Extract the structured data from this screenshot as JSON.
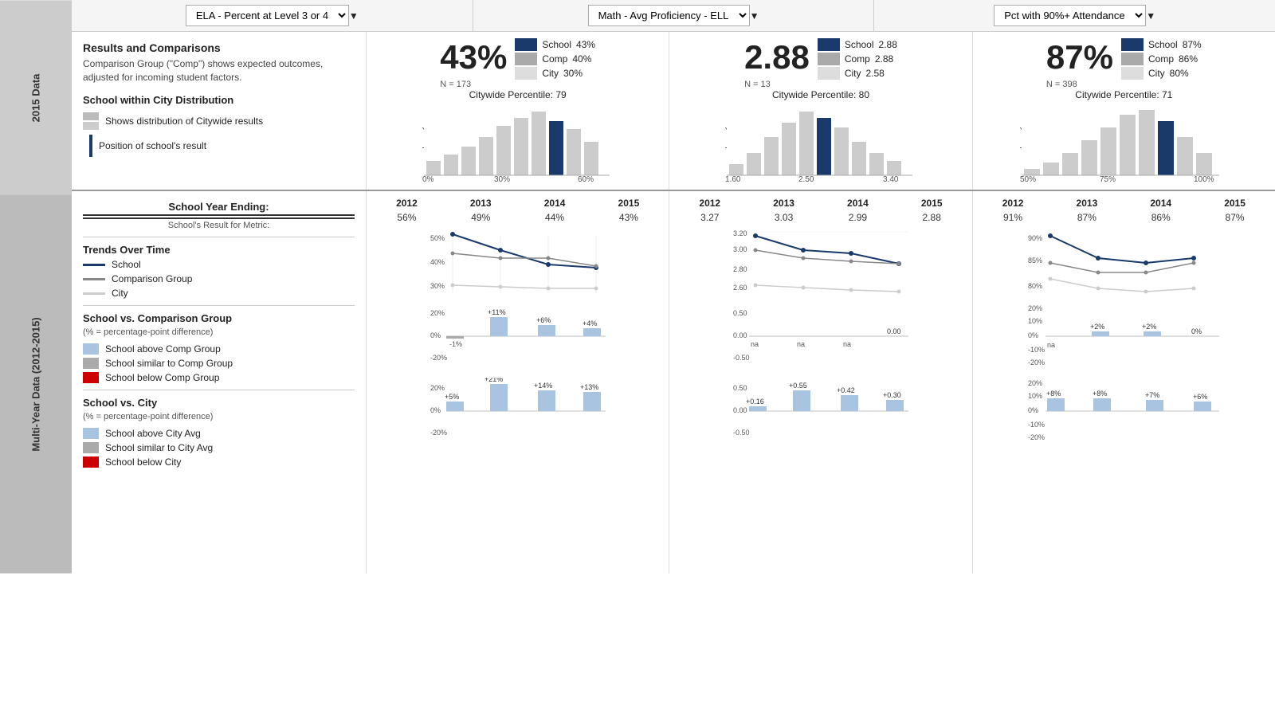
{
  "dropdowns": [
    {
      "label": "ELA - Percent at Level 3 or 4",
      "name": "ela-dropdown"
    },
    {
      "label": "Math - Avg Proficiency - ELL",
      "name": "math-dropdown"
    },
    {
      "label": "Pct with 90%+ Attendance",
      "name": "attendance-dropdown"
    }
  ],
  "sidebar_labels": [
    {
      "text": "2015 Data",
      "section": "top"
    },
    {
      "text": "Multi-Year Data (2012-2015)",
      "section": "bottom"
    }
  ],
  "results_section": {
    "title": "Results and Comparisons",
    "description": "Comparison Group (\"Comp\") shows expected outcomes, adjusted for incoming student factors.",
    "dist_legend": [
      {
        "icon": "bar",
        "text": "Shows distribution of Citywide results"
      },
      {
        "icon": "line",
        "text": "Position of school's result"
      }
    ]
  },
  "metrics": [
    {
      "id": "ela",
      "big_value": "43%",
      "n_label": "N = 173",
      "stats": [
        {
          "label": "School",
          "value": "43%",
          "swatch": "dark-blue"
        },
        {
          "label": "Comp",
          "value": "40%",
          "swatch": "gray"
        },
        {
          "label": "City",
          "value": "30%",
          "swatch": "light-gray"
        }
      ],
      "citywide_percentile": "Citywide Percentile: 79",
      "hist_bars": [
        12,
        18,
        22,
        30,
        38,
        45,
        55,
        42,
        35,
        28
      ],
      "hist_highlight": 7,
      "x_axis": [
        "0%",
        "30%",
        "60%"
      ],
      "trend_years": [
        "2012",
        "2013",
        "2014",
        "2015"
      ],
      "trend_school": [
        "56%",
        "49%",
        "44%",
        "43%"
      ],
      "trend_chart_school": [
        56,
        49,
        44,
        43
      ],
      "trend_chart_comp": [
        45,
        43,
        43,
        40
      ],
      "trend_chart_city": [
        32,
        31,
        30,
        30
      ],
      "trend_yaxis": [
        "50%",
        "40%",
        "30%"
      ],
      "vs_comp_label": "School vs. Comparison Group",
      "vs_comp_sub": "(% = percentage-point difference)",
      "vs_comp_values": [
        "-1%",
        "+11%",
        "+6%",
        "+4%"
      ],
      "vs_comp_colors": [
        "gray2",
        "blue",
        "blue",
        "blue"
      ],
      "vs_city_label": "School vs. City",
      "vs_city_sub": "(% = percentage-point difference)",
      "vs_city_values": [
        "+5%",
        "+21%",
        "+14%",
        "+13%"
      ],
      "vs_city_colors": [
        "blue",
        "blue",
        "blue",
        "blue"
      ]
    },
    {
      "id": "math",
      "big_value": "2.88",
      "n_label": "N = 13",
      "stats": [
        {
          "label": "School",
          "value": "2.88",
          "swatch": "dark-blue"
        },
        {
          "label": "Comp",
          "value": "2.88",
          "swatch": "gray"
        },
        {
          "label": "City",
          "value": "2.58",
          "swatch": "light-gray"
        }
      ],
      "citywide_percentile": "Citywide Percentile: 80",
      "hist_bars": [
        8,
        15,
        28,
        42,
        55,
        48,
        35,
        22,
        15,
        10
      ],
      "hist_highlight": 7,
      "x_axis": [
        "1.60",
        "2.50",
        "3.40"
      ],
      "trend_years": [
        "2012",
        "2013",
        "2014",
        "2015"
      ],
      "trend_school": [
        "3.27",
        "3.03",
        "2.99",
        "2.88"
      ],
      "trend_chart_school": [
        82,
        70,
        68,
        65
      ],
      "trend_chart_comp": [
        72,
        68,
        66,
        65
      ],
      "trend_chart_city": [
        55,
        54,
        52,
        50
      ],
      "trend_yaxis": [
        "3.20",
        "3.00",
        "2.80",
        "2.60"
      ],
      "vs_comp_label": "School vs. Comparison Group",
      "vs_comp_sub": "(% = percentage-point difference)",
      "vs_comp_values": [
        "na",
        "na",
        "na",
        "0.00"
      ],
      "vs_comp_colors": [
        "none",
        "none",
        "none",
        "none"
      ],
      "vs_city_label": "School vs. City",
      "vs_city_sub": "(% = percentage-point difference)",
      "vs_city_values": [
        "+0.16",
        "+0.55",
        "+0.42",
        "+0.30"
      ],
      "vs_city_colors": [
        "blue",
        "blue",
        "blue",
        "blue"
      ]
    },
    {
      "id": "attendance",
      "big_value": "87%",
      "n_label": "N = 398",
      "stats": [
        {
          "label": "School",
          "value": "87%",
          "swatch": "dark-blue"
        },
        {
          "label": "Comp",
          "value": "86%",
          "swatch": "gray"
        },
        {
          "label": "City",
          "value": "80%",
          "swatch": "light-gray"
        }
      ],
      "citywide_percentile": "Citywide Percentile: 71",
      "hist_bars": [
        5,
        10,
        18,
        30,
        42,
        55,
        60,
        48,
        30,
        15
      ],
      "hist_highlight": 8,
      "x_axis": [
        "50%",
        "75%",
        "100%"
      ],
      "trend_years": [
        "2012",
        "2013",
        "2014",
        "2015"
      ],
      "trend_school": [
        "91%",
        "87%",
        "86%",
        "87%"
      ],
      "trend_chart_school": [
        91,
        87,
        86,
        87
      ],
      "trend_chart_comp": [
        86,
        84,
        84,
        86
      ],
      "trend_chart_city": [
        82,
        80,
        79,
        80
      ],
      "trend_yaxis": [
        "90%",
        "85%",
        "80%"
      ],
      "vs_comp_label": "School vs. Comparison Group",
      "vs_comp_sub": "(% = percentage-point difference)",
      "vs_comp_values": [
        "na",
        "+2%",
        "+2%",
        "0%"
      ],
      "vs_comp_colors": [
        "none",
        "blue",
        "blue",
        "none"
      ],
      "vs_city_label": "School vs. City",
      "vs_city_sub": "(% = percentage-point difference)",
      "vs_city_values": [
        "+8%",
        "+8%",
        "+7%",
        "+6%"
      ],
      "vs_city_colors": [
        "blue",
        "blue",
        "blue",
        "blue"
      ]
    }
  ],
  "trends_legend": {
    "title": "Trends Over Time",
    "items": [
      {
        "type": "line",
        "style": "dark",
        "label": "School"
      },
      {
        "type": "line",
        "style": "mid",
        "label": "Comparison Group"
      },
      {
        "type": "line",
        "style": "light",
        "label": "City"
      }
    ]
  },
  "comp_legend": {
    "title": "School vs. Comparison Group",
    "sub": "(% = percentage-point difference)",
    "items": [
      {
        "type": "swatch",
        "style": "blue",
        "label": "School above Comp Group"
      },
      {
        "type": "swatch",
        "style": "gray2",
        "label": "School similar to Comp Group"
      },
      {
        "type": "swatch",
        "style": "red",
        "label": "School below Comp Group"
      }
    ]
  },
  "city_legend": {
    "title": "School vs. City",
    "sub": "(% = percentage-point difference)",
    "items": [
      {
        "type": "swatch",
        "style": "blue",
        "label": "School above City Avg"
      },
      {
        "type": "swatch",
        "style": "gray2",
        "label": "School similar to City Avg"
      },
      {
        "type": "swatch",
        "style": "red",
        "label": "School below City"
      }
    ]
  },
  "school_year_label": "School Year Ending:",
  "result_for_metric": "School's Result for Metric:"
}
